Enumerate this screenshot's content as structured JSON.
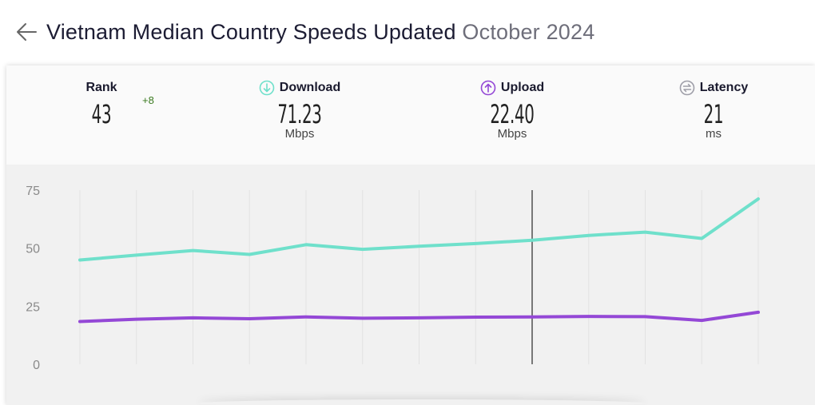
{
  "header": {
    "title": "Vietnam Median Country Speeds Updated",
    "date": "October 2024"
  },
  "stats": {
    "rank": {
      "label": "Rank",
      "value": "43",
      "change": "+8"
    },
    "download": {
      "label": "Download",
      "value": "71.23",
      "unit": "Mbps"
    },
    "upload": {
      "label": "Upload",
      "value": "22.40",
      "unit": "Mbps"
    },
    "latency": {
      "label": "Latency",
      "value": "21",
      "unit": "ms"
    }
  },
  "colors": {
    "download": "#6fe0cb",
    "upload": "#9448d6",
    "latency": "#9e9ea8",
    "rank_change": "#3a7a1f"
  },
  "chart_data": {
    "type": "line",
    "ylim": [
      0,
      75
    ],
    "yticks": [
      0,
      25,
      50,
      75
    ],
    "grid": true,
    "x": [
      1,
      2,
      3,
      4,
      5,
      6,
      7,
      8,
      9,
      10,
      11,
      12,
      13
    ],
    "highlight_x": 9,
    "series": [
      {
        "key": "download",
        "values": [
          44.9,
          47.0,
          49.0,
          47.3,
          51.5,
          49.5,
          50.8,
          52.0,
          53.4,
          55.5,
          56.9,
          54.2,
          71.23
        ]
      },
      {
        "key": "upload",
        "values": [
          18.4,
          19.4,
          20.0,
          19.6,
          20.4,
          19.8,
          20.0,
          20.3,
          20.4,
          20.6,
          20.5,
          18.9,
          22.4
        ]
      }
    ]
  }
}
